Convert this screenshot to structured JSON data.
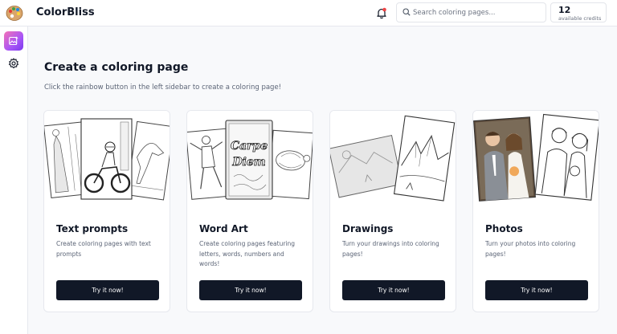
{
  "header": {
    "brand": "ColorBliss",
    "search_placeholder": "Search coloring pages...",
    "credits_count": "12",
    "credits_label": "available credits"
  },
  "sidebar": {
    "items": [
      {
        "name": "create-coloring-page",
        "icon": "image-sparkle-icon"
      },
      {
        "name": "settings",
        "icon": "gear-icon"
      }
    ]
  },
  "main": {
    "title": "Create a coloring page",
    "subtitle": "Click the rainbow button in the left sidebar to create a coloring page!",
    "cards": [
      {
        "title": "Text prompts",
        "description": "Create coloring pages with text prompts",
        "button": "Try it now!"
      },
      {
        "title": "Word Art",
        "description": "Create coloring pages featuring letters, words, numbers and words!",
        "button": "Try it now!",
        "art_text_1": "Carpe",
        "art_text_2": "Diem"
      },
      {
        "title": "Drawings",
        "description": "Turn your drawings into coloring pages!",
        "button": "Try it now!"
      },
      {
        "title": "Photos",
        "description": "Turn your photos into coloring pages!",
        "button": "Try it now!"
      }
    ]
  },
  "colors": {
    "accent_gradient_start": "#f472b6",
    "accent_gradient_end": "#7c3aed",
    "button_bg": "#111827",
    "notification_dot": "#ef4444"
  }
}
